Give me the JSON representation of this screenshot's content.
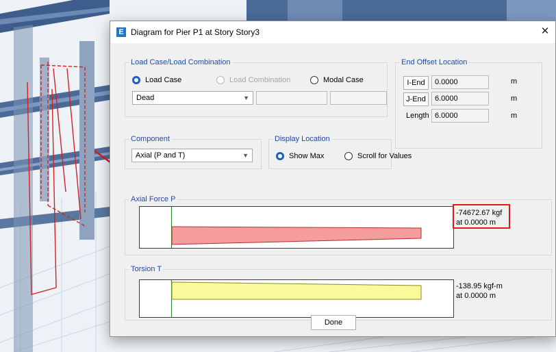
{
  "window": {
    "title": "Diagram for Pier P1 at Story Story3",
    "app_icon": "E",
    "close_glyph": "✕"
  },
  "load_case": {
    "group_title": "Load Case/Load Combination",
    "options": [
      "Load Case",
      "Load Combination",
      "Modal Case"
    ],
    "selected_option": "Load Case",
    "case_value": "Dead"
  },
  "end_offset": {
    "group_title": "End Offset Location",
    "i_end_label": "I-End",
    "i_end_value": "0.0000",
    "j_end_label": "J-End",
    "j_end_value": "6.0000",
    "length_label": "Length",
    "length_value": "6.0000",
    "unit": "m"
  },
  "component": {
    "group_title": "Component",
    "value": "Axial (P and T)"
  },
  "display_location": {
    "group_title": "Display Location",
    "options": [
      "Show Max",
      "Scroll for Values"
    ],
    "selected_option": "Show Max"
  },
  "axial": {
    "group_title": "Axial Force P",
    "result_value": "-74672.67 kgf",
    "result_location": "at 0.0000 m",
    "fill_color": "#f59c9c"
  },
  "torsion": {
    "group_title": "Torsion T",
    "result_value": "-138.95 kgf-m",
    "result_location": "at 0.0000 m",
    "fill_color": "#fafa9a"
  },
  "done_label": "Done",
  "colors": {
    "accent_blue": "#1f4aa8",
    "highlight_red": "#e01818",
    "baseline_green": "#248a2b"
  }
}
